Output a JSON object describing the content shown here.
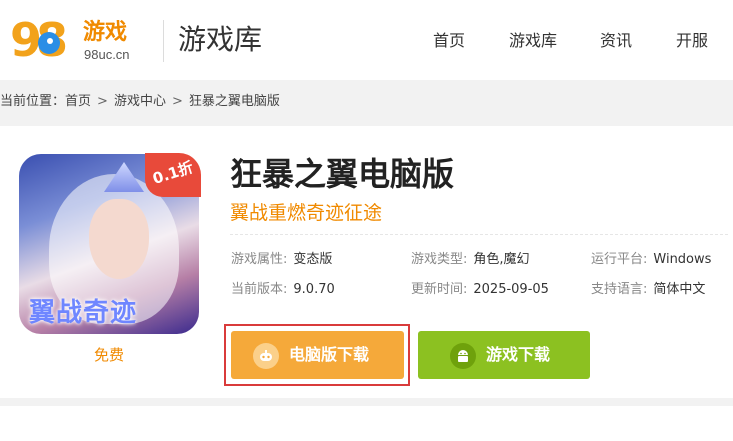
{
  "logo": {
    "number": "98",
    "game": "游戏",
    "domain": "98uc.cn"
  },
  "header": {
    "title": "游戏库"
  },
  "nav": [
    {
      "label": "首页"
    },
    {
      "label": "游戏库"
    },
    {
      "label": "资讯"
    },
    {
      "label": "开服"
    }
  ],
  "breadcrumb": {
    "prefix": "当前位置：",
    "items": [
      "首页",
      "游戏中心",
      "狂暴之翼电脑版"
    ],
    "separator": ">"
  },
  "game": {
    "title": "狂暴之翼电脑版",
    "subtitle": "翼战重燃奇迹征途",
    "badge": "0.1折",
    "cover_text": "翼战奇迹",
    "price": "免费",
    "info": [
      {
        "key": "游戏属性:",
        "value": "变态版"
      },
      {
        "key": "游戏类型:",
        "value": "角色,魔幻"
      },
      {
        "key": "运行平台:",
        "value": "Windows"
      },
      {
        "key": "当前版本:",
        "value": "9.0.70"
      },
      {
        "key": "更新时间:",
        "value": "2025-09-05"
      },
      {
        "key": "支持语言:",
        "value": "简体中文"
      }
    ]
  },
  "buttons": {
    "pc_download": "电脑版下载",
    "game_download": "游戏下载"
  },
  "colors": {
    "accent_orange": "#f08a00",
    "pc_button": "#f5a93a",
    "game_button": "#8cc121",
    "highlight": "#d93b3b"
  }
}
